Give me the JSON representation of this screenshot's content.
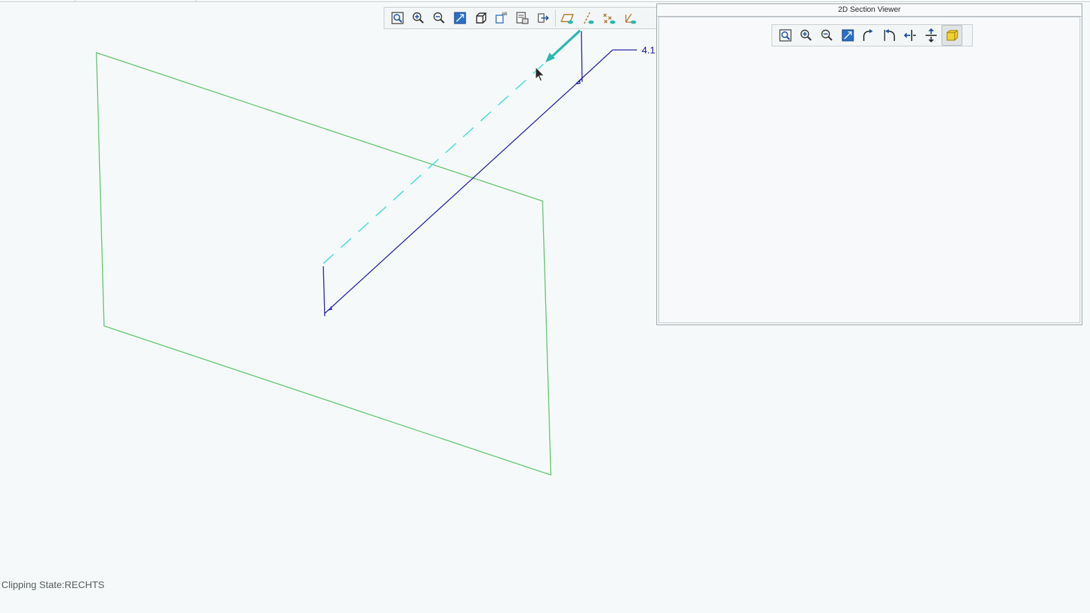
{
  "colors": {
    "background": "#f6f9f9",
    "plane_outline": "#59c36a",
    "section_line": "#1a1aa8",
    "projection_dash": "#45dede",
    "arrow": "#2bb8b0"
  },
  "main_toolbar": {
    "buttons": [
      {
        "name": "zoom-fit-icon"
      },
      {
        "name": "zoom-in-icon"
      },
      {
        "name": "zoom-out-icon"
      },
      {
        "name": "zoom-area-icon"
      },
      {
        "name": "view-cube-icon"
      },
      {
        "name": "view-label-icon"
      },
      {
        "name": "save-view-icon"
      },
      {
        "name": "insert-point-icon"
      },
      {
        "name": "plane-visibility-icon"
      },
      {
        "name": "axis-visibility-icon"
      },
      {
        "name": "points-visibility-icon"
      },
      {
        "name": "csys-visibility-icon"
      }
    ]
  },
  "section_viewer": {
    "title": "2D Section Viewer",
    "buttons": [
      {
        "name": "zoom-fit-icon"
      },
      {
        "name": "zoom-in-icon"
      },
      {
        "name": "zoom-out-icon"
      },
      {
        "name": "zoom-area-icon"
      },
      {
        "name": "rotate-right-icon"
      },
      {
        "name": "rotate-left-icon"
      },
      {
        "name": "flip-horizontal-icon"
      },
      {
        "name": "flip-vertical-icon"
      },
      {
        "name": "shade-section-icon",
        "active": true
      }
    ]
  },
  "dimension_label": "4.1",
  "status": {
    "clipping_state": "Clipping State:RECHTS"
  }
}
